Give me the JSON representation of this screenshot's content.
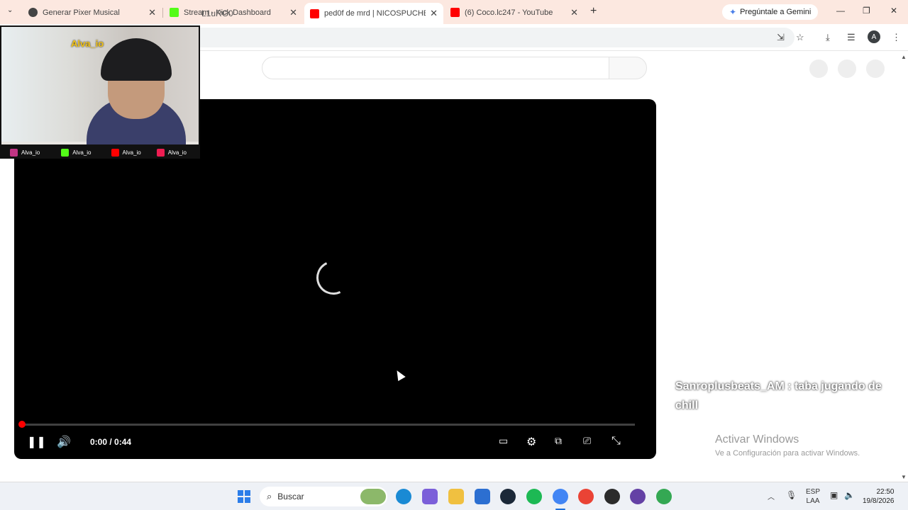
{
  "browser": {
    "tabs": [
      {
        "title": "Generar Pixer Musical",
        "favicon_color": "#444444",
        "active": false
      },
      {
        "title": "Stream - Kick Dashboard",
        "favicon_color": "#53fc18",
        "active": false
      },
      {
        "title": "ped0f de mrd | NICOSPUCHES -",
        "favicon_color": "#ff0000",
        "active": true
      },
      {
        "title": "(6) Coco.lc247 - YouTube",
        "favicon_color": "#ff0000",
        "active": false
      }
    ],
    "close_glyph": "✕",
    "new_tab_glyph": "+",
    "gemini_label": "Pregúntale a Gemini",
    "url_fragment": "L1uRG0",
    "profile_initial": "A"
  },
  "player": {
    "time_display": "0:00 / 0:44",
    "progress_fraction": 0.0
  },
  "overlay": {
    "chat_user": "Sanroplusbeats_AM",
    "chat_separator": ":",
    "chat_text": "taba jugando de chill",
    "activate_title": "Activar Windows",
    "activate_sub": "Ve a Configuración para activar Windows."
  },
  "webcam": {
    "handle": "Alva_io",
    "socials": [
      {
        "name": "instagram",
        "label": "Alva_io",
        "color": "#c13584"
      },
      {
        "name": "kick",
        "label": "Alva_io",
        "color": "#53fc18"
      },
      {
        "name": "youtube",
        "label": "Alva_io",
        "color": "#ff0000"
      },
      {
        "name": "tiktok",
        "label": "Alva_io",
        "color": "#ee1d52"
      }
    ]
  },
  "taskbar": {
    "search_placeholder": "Buscar",
    "lang_top": "ESP",
    "lang_bottom": "LAA",
    "time": "22:50",
    "date": "19/8/2026"
  }
}
